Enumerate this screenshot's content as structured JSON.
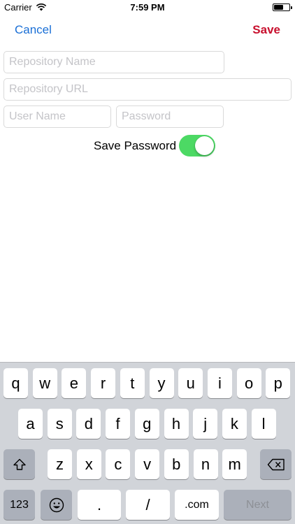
{
  "status_bar": {
    "carrier": "Carrier",
    "time": "7:59 PM",
    "battery_level": 0.6
  },
  "nav": {
    "cancel_label": "Cancel",
    "save_label": "Save"
  },
  "form": {
    "repo_name_placeholder": "Repository Name",
    "repo_url_placeholder": "Repository URL",
    "user_name_placeholder": "User Name",
    "password_placeholder": "Password",
    "save_password_label": "Save Password",
    "save_password_on": true
  },
  "keyboard": {
    "row1": [
      "q",
      "w",
      "e",
      "r",
      "t",
      "y",
      "u",
      "i",
      "o",
      "p"
    ],
    "row2": [
      "a",
      "s",
      "d",
      "f",
      "g",
      "h",
      "j",
      "k",
      "l"
    ],
    "row3": [
      "z",
      "x",
      "c",
      "v",
      "b",
      "n",
      "m"
    ],
    "numbers_label": "123",
    "dot_label": ".",
    "slash_label": "/",
    "dotcom_label": ".com",
    "next_label": "Next"
  },
  "colors": {
    "accent_blue": "#1a6fd6",
    "save_red": "#c8102e",
    "toggle_green": "#4cd964"
  },
  "icons": {
    "shift": "shift-icon",
    "delete": "delete-icon",
    "emoji": "emoji-icon",
    "wifi": "wifi-icon",
    "battery": "battery-icon"
  }
}
